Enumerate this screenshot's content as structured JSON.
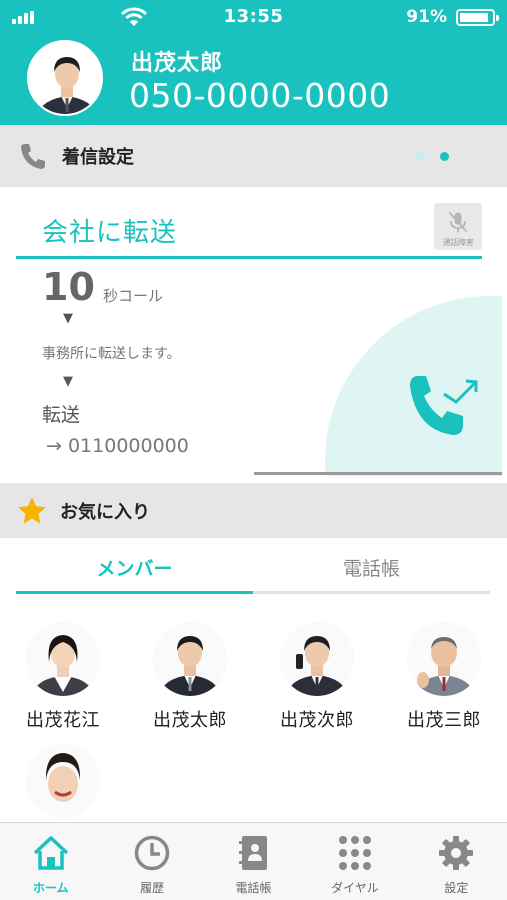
{
  "status": {
    "time": "13:55",
    "battery": "91%",
    "battery_level": 0.91
  },
  "user": {
    "name": "出茂太郎",
    "phone": "050-0000-0000"
  },
  "incoming": {
    "section_title": "着信設定",
    "page_count": 2,
    "active_page": 2
  },
  "forward": {
    "title": "会社に転送",
    "mute_label": "通話障害",
    "seconds": "10",
    "seconds_unit": "秒コール",
    "arrow": "▼",
    "message": "事務所に転送します。",
    "forward_label": "転送",
    "forward_number": "→ 0110000000"
  },
  "favorites": {
    "section_title": "お気に入り",
    "tabs": [
      {
        "label": "メンバー",
        "active": true
      },
      {
        "label": "電話帳",
        "active": false
      }
    ],
    "members": [
      {
        "name": "出茂花江"
      },
      {
        "name": "出茂太郎"
      },
      {
        "name": "出茂次郎"
      },
      {
        "name": "出茂三郎"
      },
      {
        "name": ""
      }
    ]
  },
  "nav": {
    "items": [
      {
        "label": "ホーム",
        "icon": "home-icon",
        "active": true
      },
      {
        "label": "履歴",
        "icon": "clock-icon",
        "active": false
      },
      {
        "label": "電話帳",
        "icon": "contacts-book-icon",
        "active": false
      },
      {
        "label": "ダイヤル",
        "icon": "dialpad-icon",
        "active": false
      },
      {
        "label": "設定",
        "icon": "gear-icon",
        "active": false
      }
    ]
  },
  "colors": {
    "accent": "#19c2bf",
    "bar": "#e6e6e6",
    "star": "#f5b400"
  }
}
